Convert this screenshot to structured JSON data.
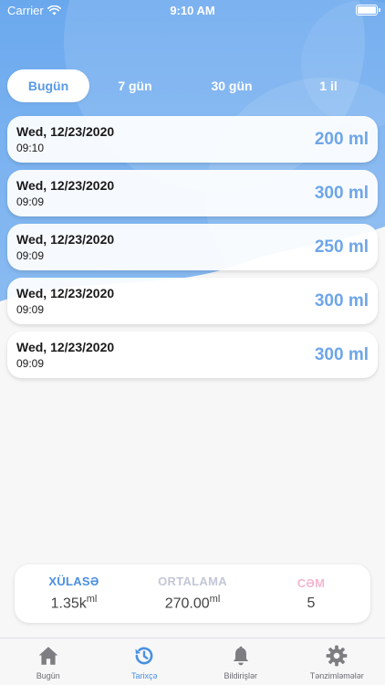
{
  "status_bar": {
    "carrier": "Carrier",
    "time": "9:10 AM"
  },
  "period_tabs": [
    {
      "label": "Bugün",
      "active": true
    },
    {
      "label": "7 gün",
      "active": false
    },
    {
      "label": "30 gün",
      "active": false
    },
    {
      "label": "1 il",
      "active": false
    }
  ],
  "entries": [
    {
      "date": "Wed, 12/23/2020",
      "time": "09:10",
      "amount": "200 ml"
    },
    {
      "date": "Wed, 12/23/2020",
      "time": "09:09",
      "amount": "300 ml"
    },
    {
      "date": "Wed, 12/23/2020",
      "time": "09:09",
      "amount": "250 ml"
    },
    {
      "date": "Wed, 12/23/2020",
      "time": "09:09",
      "amount": "300 ml"
    },
    {
      "date": "Wed, 12/23/2020",
      "time": "09:09",
      "amount": "300 ml"
    }
  ],
  "summary": {
    "total": {
      "title": "XÜLASƏ",
      "value": "1.35k",
      "unit": "ml",
      "color": "#4a8fe0"
    },
    "average": {
      "title": "ORTALAMA",
      "value": "270.00",
      "unit": "ml",
      "color": "#c3c7d6"
    },
    "count": {
      "title": "CƏM",
      "value": "5",
      "color": "#f4b6d0"
    }
  },
  "bottom_tabs": [
    {
      "label": "Bugün",
      "icon": "home-icon",
      "active": false
    },
    {
      "label": "Tarixçə",
      "icon": "history-icon",
      "active": true
    },
    {
      "label": "Bildirişlər",
      "icon": "bell-icon",
      "active": false
    },
    {
      "label": "Tənzimləmələr",
      "icon": "gear-icon",
      "active": false
    }
  ],
  "colors": {
    "accent": "#4a90e2",
    "amount": "#6ea6e8",
    "inactive_icon": "#7d7d82"
  }
}
